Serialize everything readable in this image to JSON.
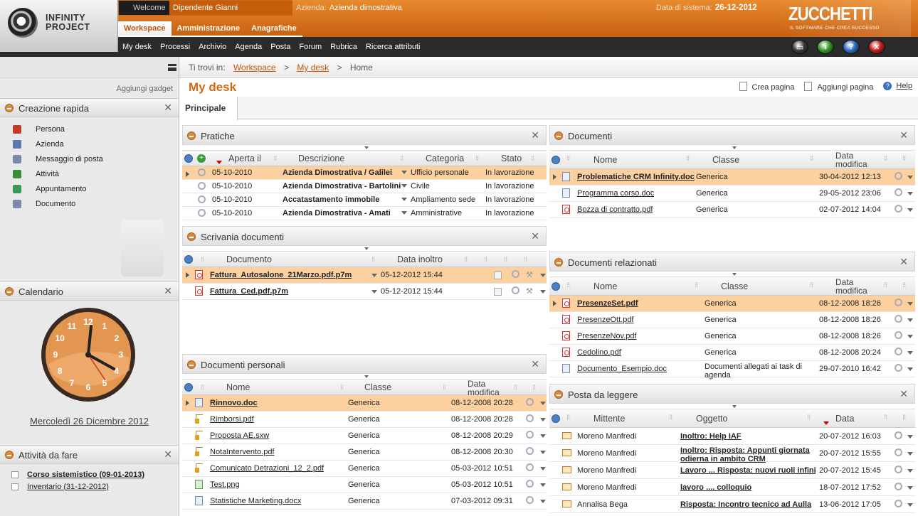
{
  "header": {
    "logo_line1": "INFINITY",
    "logo_line2": "PROJECT",
    "welcome_label": "Welcome",
    "welcome_user": "Dipendente Gianni",
    "azienda_label": "Azienda:",
    "azienda_value": "Azienda dimostrativa",
    "data_label": "Data di sistema:",
    "data_value": "26-12-2012",
    "brand_name": "ZUCCHETTI",
    "brand_tagline": "IL SOFTWARE CHE CREA SUCCESSO",
    "tabs": [
      "Workspace",
      "Amministrazione",
      "Anagrafiche"
    ],
    "sub_nav": [
      "My desk",
      "Processi",
      "Archivio",
      "Agenda",
      "Posta",
      "Forum",
      "Rubrica",
      "Ricerca attributi"
    ],
    "round_buttons": [
      {
        "name": "monitor-icon",
        "glyph": "▭",
        "color": "#3c3c3c"
      },
      {
        "name": "info-icon",
        "glyph": "i",
        "color": "#3a9a2a"
      },
      {
        "name": "help-icon",
        "glyph": "?",
        "color": "#2e6fc4"
      },
      {
        "name": "logout-icon",
        "glyph": "✕",
        "color": "#c42020"
      }
    ],
    "accent": "#d46914"
  },
  "sidebar": {
    "aggiungi_gadget": "Aggiungi gadget",
    "creazione_title": "Creazione rapida",
    "quick_items": [
      {
        "label": "Persona",
        "icon": "person-icon",
        "color": "#c0392b"
      },
      {
        "label": "Azienda",
        "icon": "building-icon",
        "color": "#5a7ab0"
      },
      {
        "label": "Messaggio di posta",
        "icon": "mail-icon",
        "color": "#7a8aa8"
      },
      {
        "label": "Attività",
        "icon": "activity-icon",
        "color": "#3a8a3a"
      },
      {
        "label": "Appuntamento",
        "icon": "appointment-icon",
        "color": "#3a9a5a"
      },
      {
        "label": "Documento",
        "icon": "document-icon",
        "color": "#7a8aa8"
      }
    ],
    "calendario_title": "Calendario",
    "calendar_date": "Mercoledì 26 Dicembre 2012",
    "clock_numbers": [
      "12",
      "1",
      "2",
      "3",
      "4",
      "5",
      "6",
      "7",
      "8",
      "9",
      "10",
      "11"
    ],
    "attivita_title": "Attività da fare",
    "todo": [
      "Corso sistemistico (09-01-2013)",
      "Inventario (31-12-2012)"
    ]
  },
  "main": {
    "breadcrumb_label": "Ti trovi in:",
    "breadcrumb": [
      "Workspace",
      "My desk",
      "Home"
    ],
    "page_title": "My desk",
    "crea_pagina": "Crea pagina",
    "aggiungi_pagina": "Aggiungi pagina",
    "help": "Help",
    "tab": "Principale"
  },
  "pratiche": {
    "title": "Pratiche",
    "headers": [
      "Aperta il",
      "Descrizione",
      "Categoria",
      "Stato"
    ],
    "rows": [
      [
        "05-10-2010",
        "Azienda Dimostrativa / Galilei",
        "Ufficio personale",
        "In lavorazione"
      ],
      [
        "05-10-2010",
        "Azienda Dimostrativa - Bartolini",
        "Civile",
        "In lavorazione"
      ],
      [
        "05-10-2010",
        "Accatastamento immobile",
        "Ampliamento sede",
        "In lavorazione"
      ],
      [
        "05-10-2010",
        "Azienda Dimostrativa - Amati",
        "Amministrative",
        "In lavorazione"
      ]
    ]
  },
  "scrivania": {
    "title": "Scrivania documenti",
    "headers": [
      "Documento",
      "Data inoltro"
    ],
    "rows": [
      [
        "Fattura_Autosalone_21Marzo.pdf.p7m",
        "05-12-2012 15:44"
      ],
      [
        "Fattura_Ced.pdf.p7m",
        "05-12-2012 15:44"
      ]
    ]
  },
  "personali": {
    "title": "Documenti personali",
    "headers": [
      "Nome",
      "Classe",
      "Data",
      "modifica"
    ],
    "rows": [
      [
        "Rinnovo.doc",
        "Generica",
        "08-12-2008 20:28"
      ],
      [
        "Rimborsi.pdf",
        "Generica",
        "08-12-2008 20:28"
      ],
      [
        "Proposta AE.sxw",
        "Generica",
        "08-12-2008 20:29"
      ],
      [
        "NotaIntervento.pdf",
        "Generica",
        "08-12-2008 20:30"
      ],
      [
        "Comunicato Detrazioni_12_2.pdf",
        "Generica",
        "05-03-2012 10:51"
      ],
      [
        "Test.png",
        "Generica",
        "05-03-2012 10:51"
      ],
      [
        "Statistiche Marketing.docx",
        "Generica",
        "07-03-2012 09:31"
      ]
    ]
  },
  "documenti": {
    "title": "Documenti",
    "headers": [
      "Nome",
      "Classe",
      "Data",
      "modifica"
    ],
    "rows": [
      [
        "Problematiche CRM Infinity.doc",
        "Generica",
        "30-04-2012 12:13"
      ],
      [
        "Programma corso.doc",
        "Generica",
        "29-05-2012 23:06"
      ],
      [
        "Bozza di contratto.pdf",
        "Generica",
        "02-07-2012 14:04"
      ]
    ]
  },
  "relazionati": {
    "title": "Documenti relazionati",
    "headers": [
      "Nome",
      "Classe",
      "Data",
      "modifica"
    ],
    "rows": [
      [
        "PresenzeSet.pdf",
        "Generica",
        "08-12-2008 18:26"
      ],
      [
        "PresenzeOtt.pdf",
        "Generica",
        "08-12-2008 18:26"
      ],
      [
        "PresenzeNov.pdf",
        "Generica",
        "08-12-2008 18:26"
      ],
      [
        "Cedolino.pdf",
        "Generica",
        "08-12-2008 20:24"
      ],
      [
        "Documento_Esempio.doc",
        "Documenti allegati ai task di agenda",
        "29-07-2010 16:42"
      ]
    ]
  },
  "posta": {
    "title": "Posta da leggere",
    "headers": [
      "Mittente",
      "Oggetto",
      "Data"
    ],
    "rows": [
      [
        "Moreno Manfredi",
        "Inoltro: Help IAF",
        "20-07-2012 16:03"
      ],
      [
        "Moreno Manfredi",
        "Inoltro: Risposta: Appunti giornata odierna in ambito CRM",
        "20-07-2012 15:55"
      ],
      [
        "Moreno Manfredi",
        "Lavoro ... Risposta: nuovi ruoli infinity",
        "20-07-2012 15:45"
      ],
      [
        "Moreno Manfredi",
        "lavoro .... colloquio",
        "18-07-2012 17:52"
      ],
      [
        "Annalisa Bega",
        "Risposta: Incontro tecnico ad Aulla",
        "13-06-2012 17:05"
      ]
    ]
  }
}
